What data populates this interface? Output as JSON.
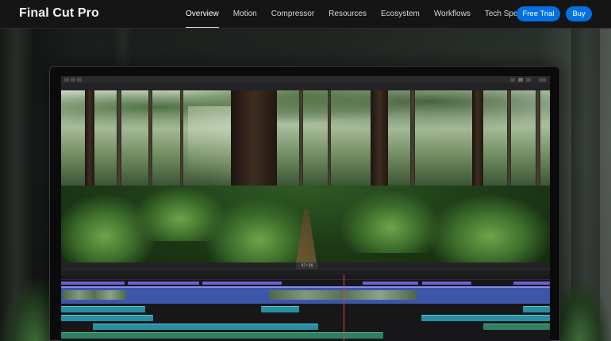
{
  "nav": {
    "brand": "Final Cut Pro",
    "links": [
      {
        "label": "Overview",
        "active": true
      },
      {
        "label": "Motion",
        "active": false
      },
      {
        "label": "Compressor",
        "active": false
      },
      {
        "label": "Resources",
        "active": false
      },
      {
        "label": "Ecosystem",
        "active": false
      },
      {
        "label": "Workflows",
        "active": false
      },
      {
        "label": "Tech Specs",
        "active": false
      }
    ],
    "free_trial": "Free Trial",
    "buy": "Buy"
  },
  "app": {
    "timecode": "57:26",
    "accent_color": "#0071e3",
    "playhead_color": "#e04040"
  }
}
